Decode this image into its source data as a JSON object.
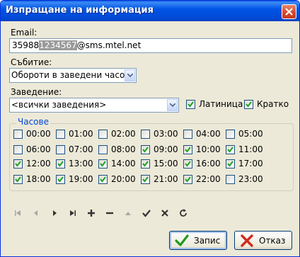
{
  "window": {
    "title": "Изпращане на информация"
  },
  "email": {
    "label": "Email:",
    "prefix": "35988",
    "selected": "1234567",
    "suffix": "@sms.mtel.net"
  },
  "event": {
    "label": "Събитие:",
    "value": "Обороти в заведени часове"
  },
  "venue": {
    "label": "Заведение:",
    "value": "<всички заведения>"
  },
  "options": {
    "latin_label": "Латиница",
    "latin_checked": true,
    "short_label": "Кратко",
    "short_checked": true
  },
  "hours": {
    "group_label": "Часове",
    "items": [
      {
        "label": "00:00",
        "checked": false
      },
      {
        "label": "01:00",
        "checked": false
      },
      {
        "label": "02:00",
        "checked": false
      },
      {
        "label": "03:00",
        "checked": false
      },
      {
        "label": "04:00",
        "checked": false
      },
      {
        "label": "05:00",
        "checked": false
      },
      {
        "label": "06:00",
        "checked": false
      },
      {
        "label": "07:00",
        "checked": false
      },
      {
        "label": "08:00",
        "checked": false
      },
      {
        "label": "09:00",
        "checked": true
      },
      {
        "label": "10:00",
        "checked": true
      },
      {
        "label": "11:00",
        "checked": true
      },
      {
        "label": "12:00",
        "checked": true
      },
      {
        "label": "13:00",
        "checked": true
      },
      {
        "label": "14:00",
        "checked": true
      },
      {
        "label": "15:00",
        "checked": true
      },
      {
        "label": "16:00",
        "checked": true
      },
      {
        "label": "17:00",
        "checked": true
      },
      {
        "label": "18:00",
        "checked": true
      },
      {
        "label": "19:00",
        "checked": true
      },
      {
        "label": "20:00",
        "checked": true
      },
      {
        "label": "21:00",
        "checked": true
      },
      {
        "label": "22:00",
        "checked": true
      },
      {
        "label": "23:00",
        "checked": false
      }
    ]
  },
  "navigator": [
    "first-icon",
    "prior-icon",
    "next-icon",
    "last-icon",
    "insert-icon",
    "delete-icon",
    "edit-icon",
    "post-icon",
    "cancel-icon",
    "refresh-icon"
  ],
  "buttons": {
    "save_label": "Запис",
    "cancel_label": "Отказ"
  }
}
